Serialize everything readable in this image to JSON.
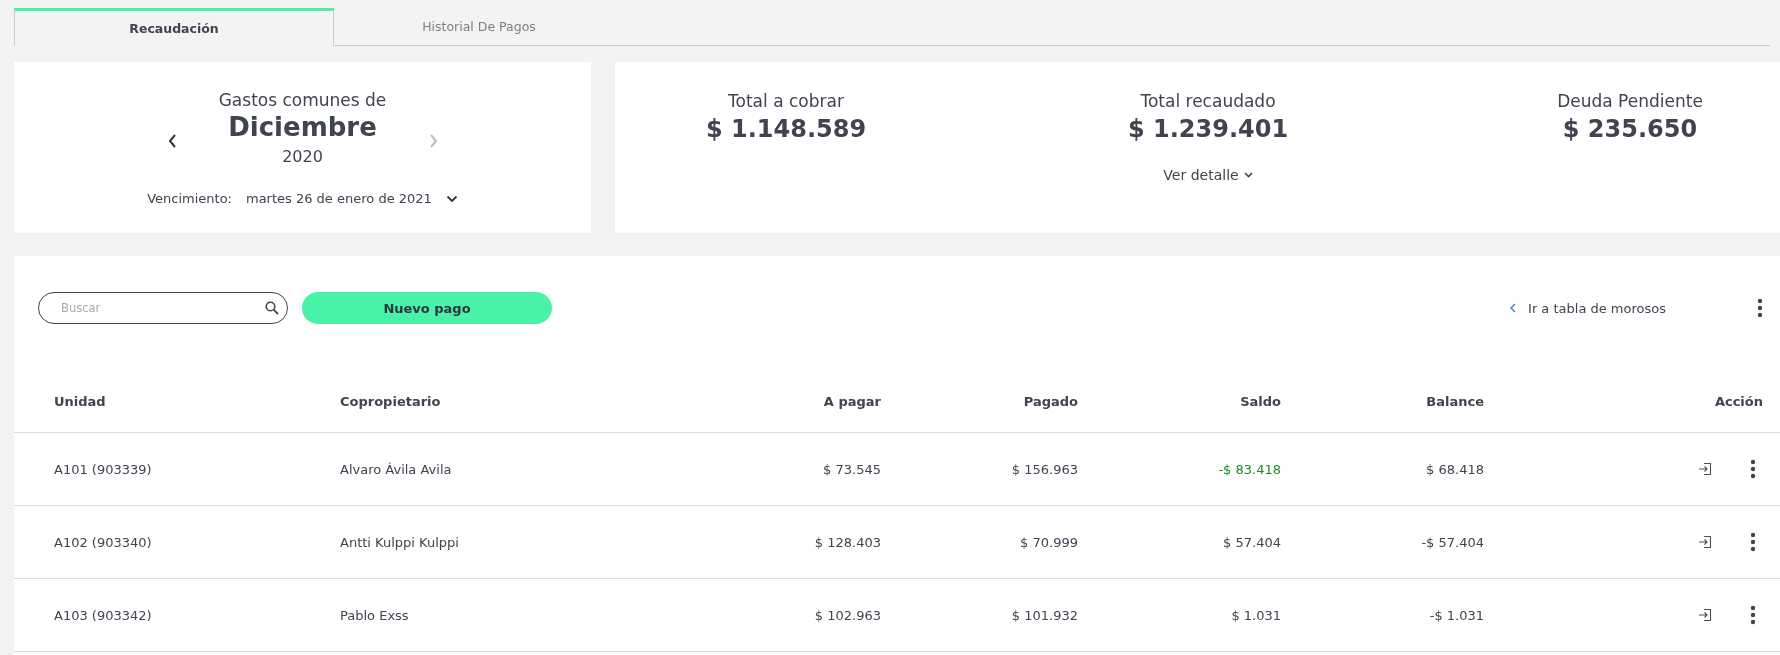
{
  "tabs": [
    {
      "label": "Recaudación",
      "selected": true
    },
    {
      "label": "Historial De Pagos",
      "selected": false
    }
  ],
  "period": {
    "caption": "Gastos comunes de",
    "month": "Diciembre",
    "year": "2020",
    "prev_disabled": false,
    "next_disabled": true,
    "due_label": "Vencimiento:",
    "due_value": "martes 26 de enero de 2021"
  },
  "totals": [
    {
      "label": "Total a cobrar",
      "amount": "$ 1.148.589"
    },
    {
      "label": "Total recaudado",
      "amount": "$ 1.239.401"
    },
    {
      "label": "Deuda Pendiente",
      "amount": "$ 235.650"
    }
  ],
  "detail_link": "Ver detalle",
  "toolbar": {
    "search_placeholder": "Buscar",
    "new_button": "Nuevo pago",
    "link": "Ir a tabla de morosos"
  },
  "table": {
    "columns": [
      "Unidad",
      "Copropietario",
      "A pagar",
      "Pagado",
      "Saldo",
      "Balance",
      "Acción"
    ],
    "rows": [
      {
        "unidad": "A101 (903339)",
        "copropietario": "Alvaro Ávila Avila",
        "a_pagar": "$ 73.545",
        "pagado": "$ 156.963",
        "saldo": {
          "text": "-$ 83.418",
          "highlight": true
        },
        "balance": "$ 68.418"
      },
      {
        "unidad": "A102 (903340)",
        "copropietario": "Antti Kulppi Kulppi",
        "a_pagar": "$ 128.403",
        "pagado": "$ 70.999",
        "saldo": {
          "text": "$ 57.404",
          "highlight": false
        },
        "balance": "-$ 57.404"
      },
      {
        "unidad": "A103 (903342)",
        "copropietario": "Pablo Exss",
        "a_pagar": "$ 102.963",
        "pagado": "$ 101.932",
        "saldo": {
          "text": "$ 1.031",
          "highlight": false
        },
        "balance": "-$ 1.031"
      }
    ]
  }
}
